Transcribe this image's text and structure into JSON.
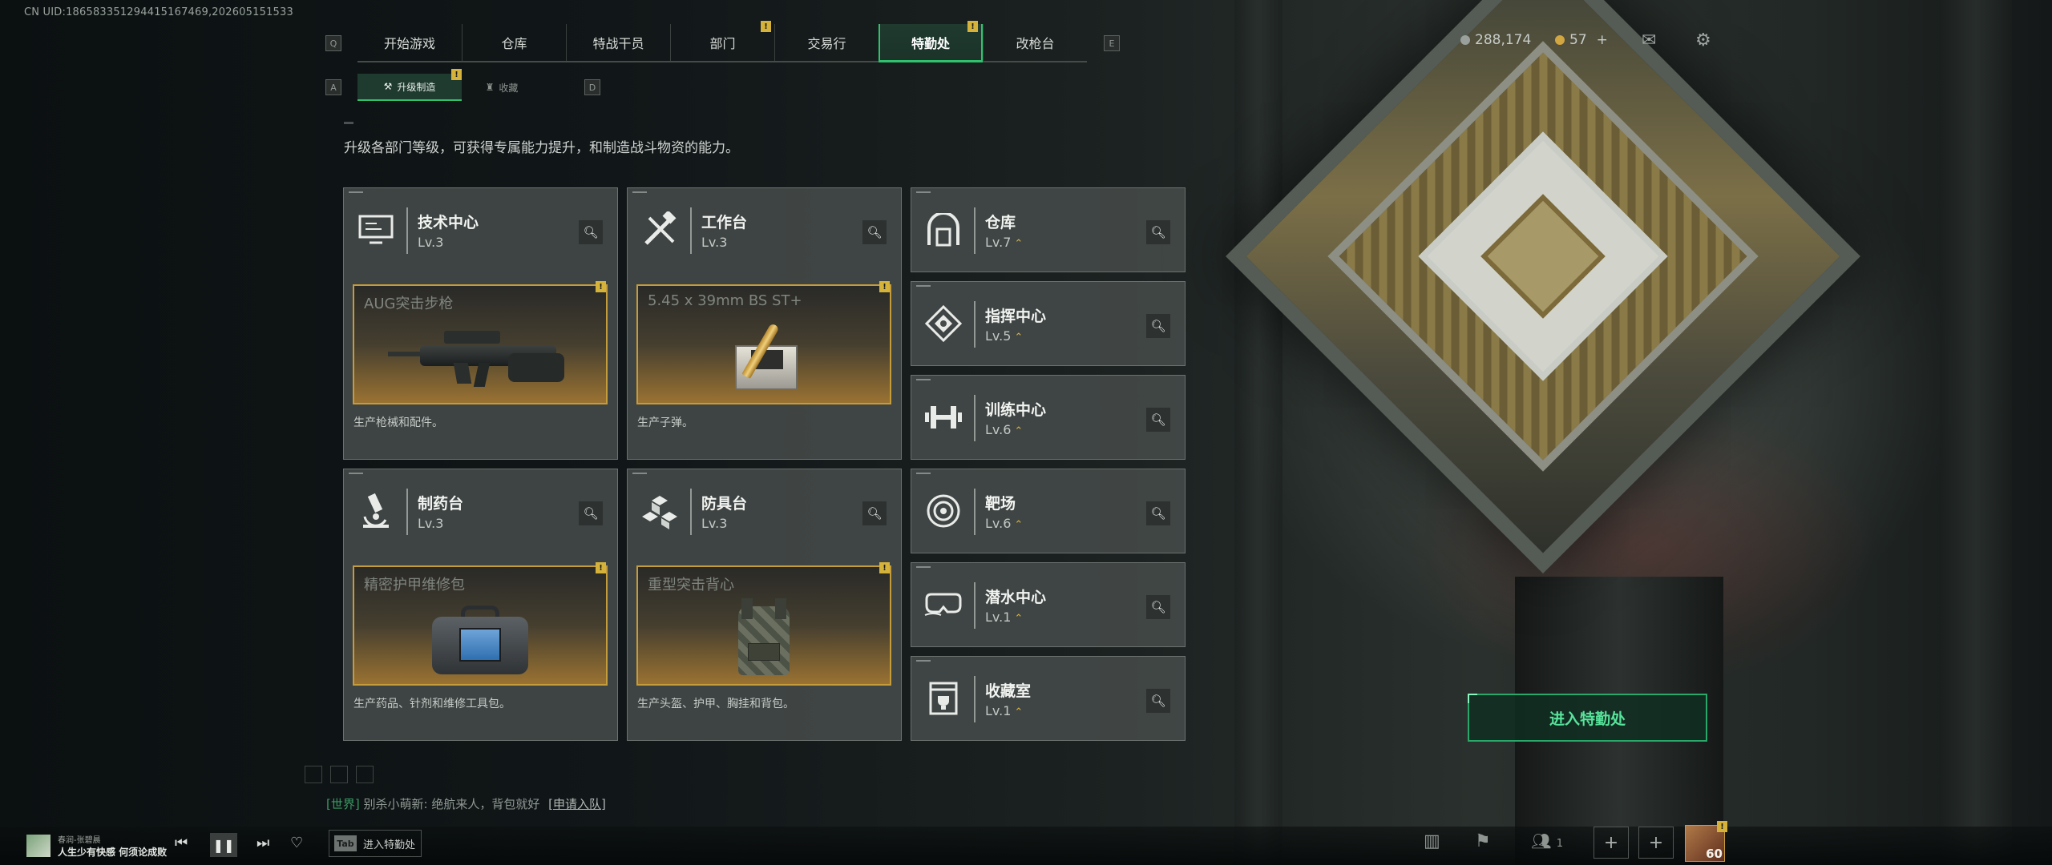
{
  "uid": "CN UID:18658335129441516746­9,202605151533",
  "nav": {
    "left_key": "Q",
    "right_key": "E",
    "tabs": [
      {
        "label": "开始游戏",
        "badge": ""
      },
      {
        "label": "仓库",
        "badge": ""
      },
      {
        "label": "特战干员",
        "badge": ""
      },
      {
        "label": "部门",
        "badge": "!"
      },
      {
        "label": "交易行",
        "badge": ""
      },
      {
        "label": "特勤处",
        "badge": "!"
      },
      {
        "label": "改枪台",
        "badge": ""
      }
    ],
    "active_index": 5
  },
  "subnav": {
    "left_key": "A",
    "right_key": "D",
    "tabs": [
      {
        "label": "升级制造",
        "badge": "!"
      },
      {
        "label": "收藏",
        "badge": ""
      }
    ]
  },
  "resources": {
    "currency": "288,174",
    "coin": "57",
    "plus": "+"
  },
  "description": "升级各部门等级，可获得专属能力提升，和制造战斗物资的能力。",
  "craft_cards": [
    {
      "name": "技术中心",
      "level": "Lv.3",
      "icon": "monitor-icon",
      "item": "AUG突击步枪",
      "item_badge": "!",
      "desc": "生产枪械和配件。"
    },
    {
      "name": "工作台",
      "level": "Lv.3",
      "icon": "tools-icon",
      "item": "5.45 x 39mm BS ST+",
      "item_badge": "!",
      "desc": "生产子弹。"
    },
    {
      "name": "制药台",
      "level": "Lv.3",
      "icon": "microscope-icon",
      "item": "精密护甲维修包",
      "item_badge": "!",
      "desc": "生产药品、针剂和维修工具包。"
    },
    {
      "name": "防具台",
      "level": "Lv.3",
      "icon": "cubes-icon",
      "item": "重型突击背心",
      "item_badge": "!",
      "desc": "生产头盔、护甲、胸挂和背包。"
    }
  ],
  "facilities": [
    {
      "name": "仓库",
      "level": "Lv.7",
      "icon": "vault-icon"
    },
    {
      "name": "指挥中心",
      "level": "Lv.5",
      "icon": "command-icon"
    },
    {
      "name": "训练中心",
      "level": "Lv.6",
      "icon": "dumbbell-icon"
    },
    {
      "name": "靶场",
      "level": "Lv.6",
      "icon": "target-icon"
    },
    {
      "name": "潜水中心",
      "level": "Lv.1",
      "icon": "goggles-icon"
    },
    {
      "name": "收藏室",
      "level": "Lv.1",
      "icon": "trophy-icon"
    }
  ],
  "enter_button": "进入特勤处",
  "chat": {
    "channel": "[世界]",
    "user": "别杀小萌新:",
    "message": "绝航来人，背包就好",
    "action": "[申请入队]"
  },
  "music": {
    "artist": "春润-张碧晨",
    "title": "人生少有快感 何须论成败"
  },
  "tab_hint": {
    "key": "Tab",
    "label": "进入特勤处"
  },
  "team": {
    "count": "1"
  },
  "player": {
    "level": "60",
    "badge": "!"
  },
  "colors": {
    "accent_green": "#2fc16e",
    "badge_gold": "#d5b33a",
    "craft_border": "#c59c3c"
  }
}
